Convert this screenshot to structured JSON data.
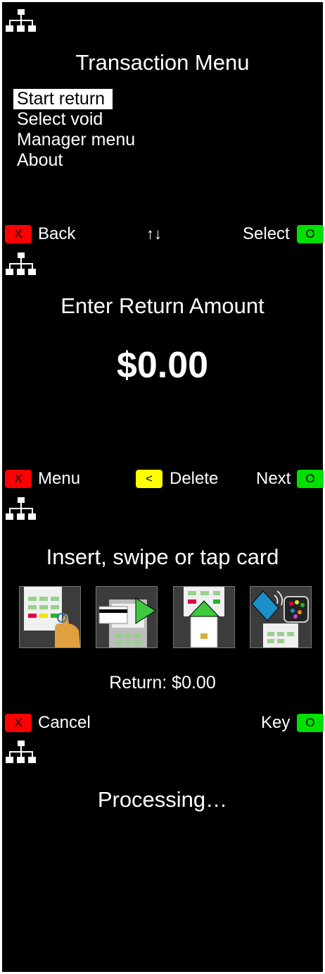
{
  "screens": {
    "transaction_menu": {
      "title": "Transaction Menu",
      "items": [
        {
          "label": "Start return",
          "selected": true
        },
        {
          "label": "Select void",
          "selected": false
        },
        {
          "label": "Manager menu",
          "selected": false
        },
        {
          "label": "About",
          "selected": false
        }
      ],
      "softkeys": {
        "left": {
          "key": "X",
          "label": "Back",
          "color": "#ff0000"
        },
        "center": {
          "label": "↑↓"
        },
        "right": {
          "key": "O",
          "label": "Select",
          "color": "#00e000"
        }
      }
    },
    "return_amount": {
      "title": "Enter Return Amount",
      "amount": "$0.00",
      "softkeys": {
        "left": {
          "key": "X",
          "label": "Menu",
          "color": "#ff0000"
        },
        "center": {
          "key": "<",
          "label": "Delete",
          "color": "#ffff00"
        },
        "right": {
          "key": "O",
          "label": "Next",
          "color": "#00e000"
        }
      }
    },
    "card_entry": {
      "title": "Insert, swipe or tap card",
      "card_methods": [
        "keypad-entry-icon",
        "swipe-card-icon",
        "insert-card-icon",
        "tap-contactless-icon"
      ],
      "return_text": "Return: $0.00",
      "softkeys": {
        "left": {
          "key": "X",
          "label": "Cancel",
          "color": "#ff0000"
        },
        "right": {
          "key": "O",
          "label": "Key",
          "color": "#00e000"
        }
      }
    },
    "processing": {
      "title": "Processing…"
    }
  },
  "icons": {
    "network": "network-icon"
  }
}
